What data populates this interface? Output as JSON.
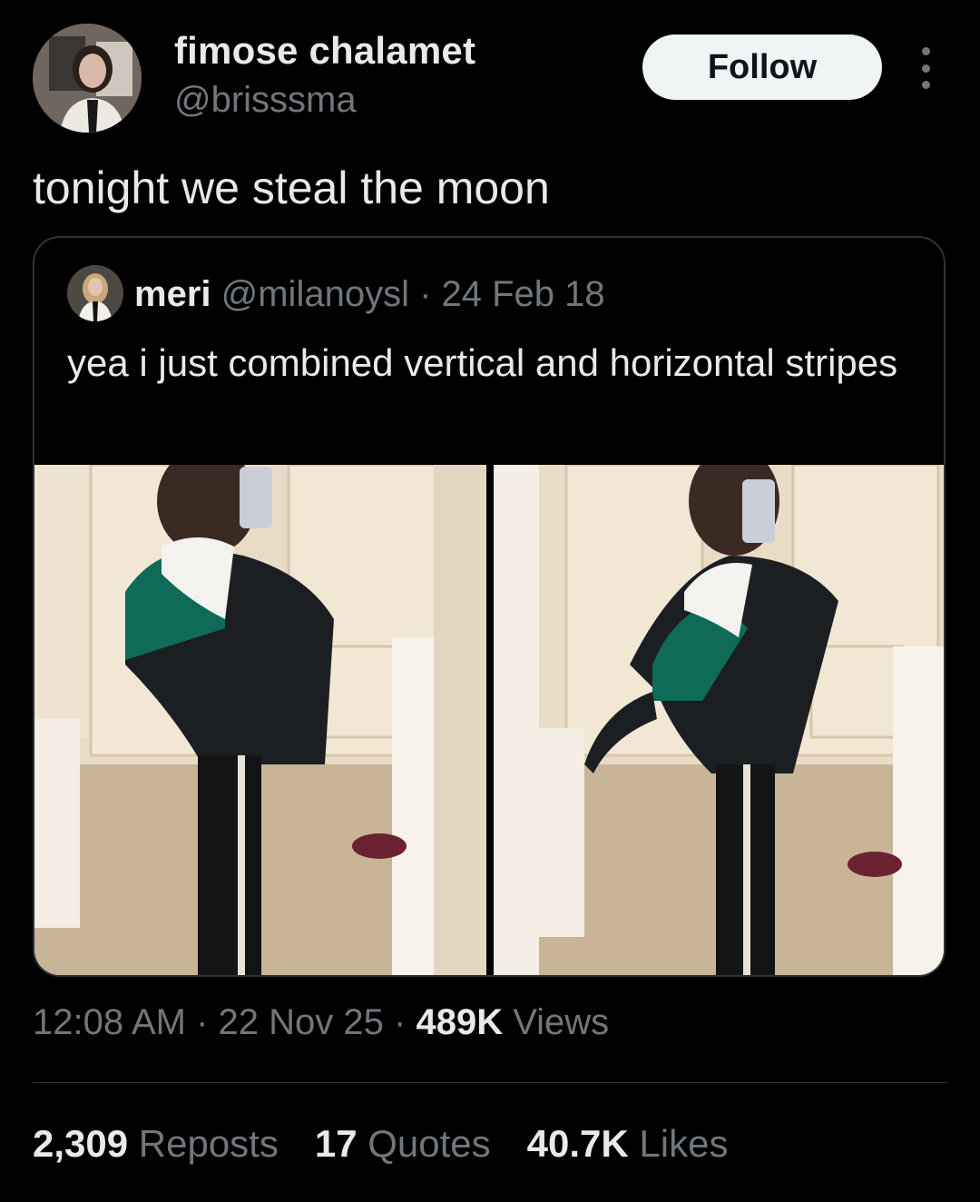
{
  "author": {
    "display_name": "fimose chalamet",
    "handle": "@brisssma",
    "avatar": "profile-photo"
  },
  "follow_label": "Follow",
  "more_icon": "more-vertical-icon",
  "tweet_text": "tonight we steal the moon",
  "quoted": {
    "name": "meri",
    "meta": "@milanoysl · 24 Feb 18",
    "text": "yea i just combined vertical and horizontal stripes",
    "photos": [
      "mirror-selfie-photo",
      "mirror-selfie-photo"
    ]
  },
  "footer": {
    "time_date": "12:08 AM · 22 Nov 25 · ",
    "views_count": "489K",
    "views_label": " Views"
  },
  "stats": {
    "reposts_count": "2,309",
    "reposts_label": " Reposts",
    "quotes_count": "17",
    "quotes_label": " Quotes",
    "likes_count": "40.7K",
    "likes_label": " Likes"
  }
}
